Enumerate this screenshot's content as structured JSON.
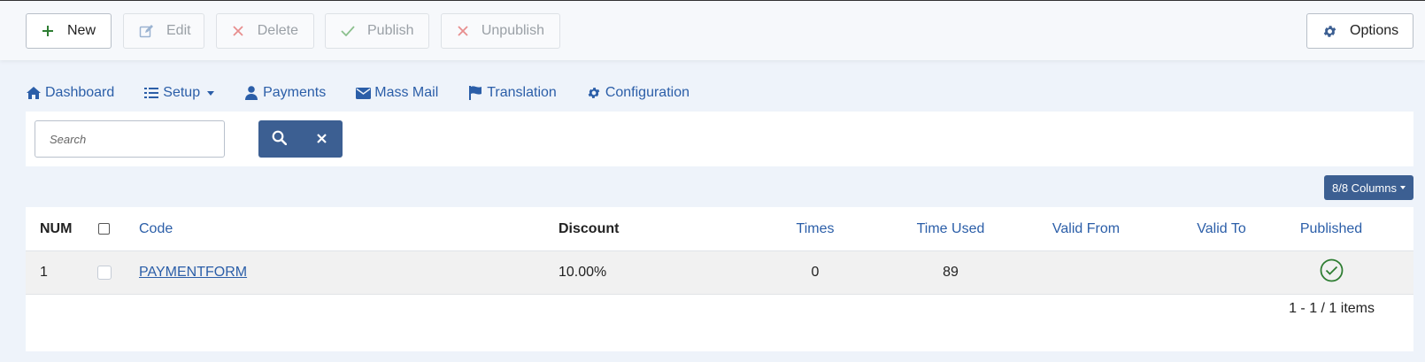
{
  "toolbar": {
    "new_label": "New",
    "edit_label": "Edit",
    "delete_label": "Delete",
    "publish_label": "Publish",
    "unpublish_label": "Unpublish",
    "options_label": "Options"
  },
  "nav": {
    "dashboard": "Dashboard",
    "setup": "Setup",
    "payments": "Payments",
    "mass_mail": "Mass Mail",
    "translation": "Translation",
    "configuration": "Configuration"
  },
  "search": {
    "placeholder": "Search"
  },
  "columns_button": "8/8 Columns",
  "table": {
    "headers": {
      "num": "NUM",
      "code": "Code",
      "discount": "Discount",
      "times": "Times",
      "time_used": "Time Used",
      "valid_from": "Valid From",
      "valid_to": "Valid To",
      "published": "Published"
    },
    "rows": [
      {
        "num": "1",
        "code": "PAYMENTFORM",
        "discount": "10.00%",
        "times": "0",
        "time_used": "89",
        "valid_from": "",
        "valid_to": "",
        "published": true
      }
    ]
  },
  "pagination": "1 - 1 / 1 items",
  "colors": {
    "accent": "#2b5ea8",
    "button_dark": "#3c5f92",
    "success": "#2e7d32",
    "danger": "#e05a5a"
  }
}
